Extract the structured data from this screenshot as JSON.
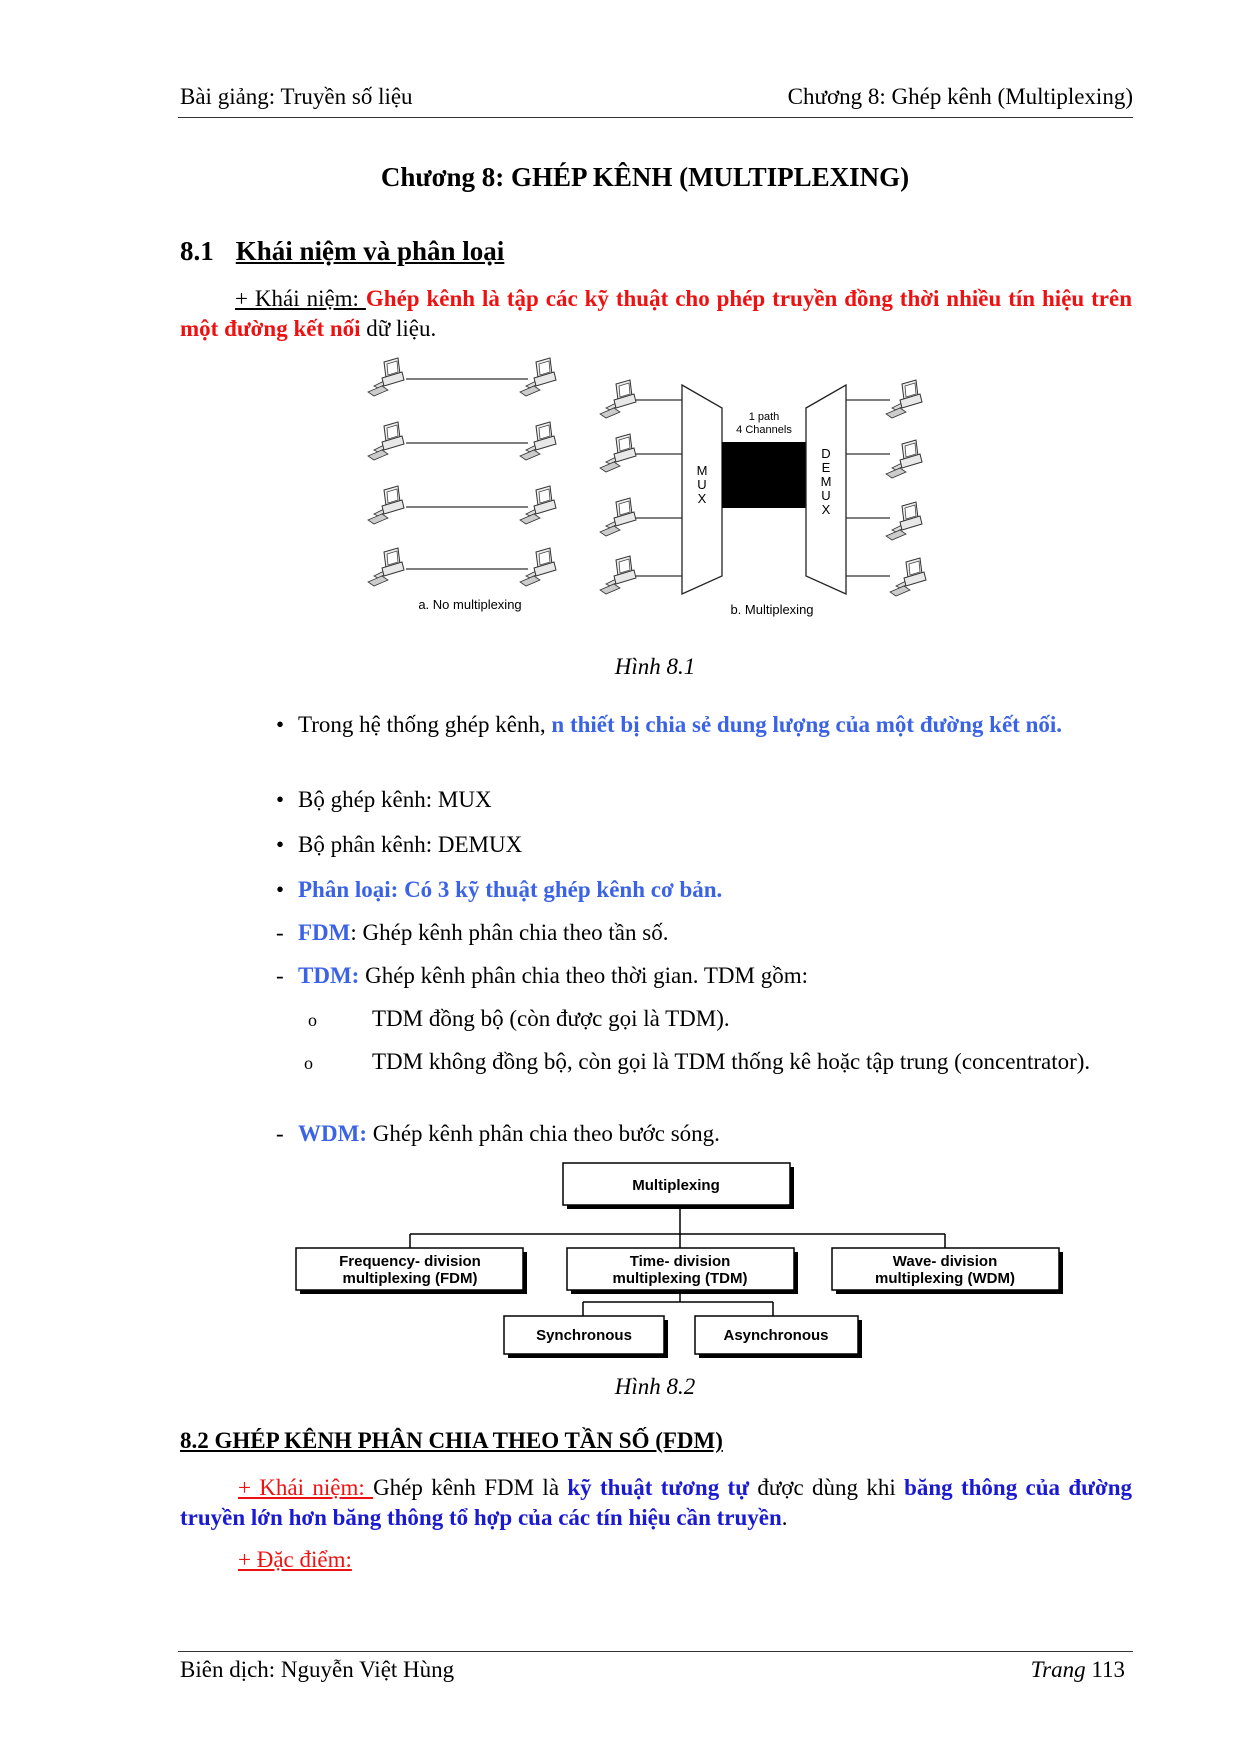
{
  "header": {
    "left": "Bài giảng: Truyền số liệu",
    "right": "Chương 8: Ghép kênh (Multiplexing)"
  },
  "chapter_title": "Chương 8: GHÉP KÊNH (MULTIPLEXING)",
  "section_8_1": {
    "number": "8.1",
    "title": "Khái niệm và phân loại",
    "concept_label": "+ Khái niệm: ",
    "concept_bold": "Ghép kênh là tập các kỹ thuật cho phép truyền đồng thời nhiều tín hiệu trên một đường kết nối",
    "concept_tail": " dữ liệu."
  },
  "figure_8_1": {
    "caption": "Hình 8.1",
    "label_a": "a. No multiplexing",
    "label_b": "b.  Multiplexing",
    "path_line1": "1 path",
    "path_line2": "4 Channels",
    "mux_letters": [
      "M",
      "U",
      "X"
    ],
    "demux_letters": [
      "D",
      "E",
      "M",
      "U",
      "X"
    ]
  },
  "bullets": [
    {
      "plain": "Trong hệ thống ghép kênh, ",
      "highlight": "n thiết bị chia sẻ dung lượng của một đường kết nối."
    },
    {
      "plain": "Bộ ghép kênh: MUX"
    },
    {
      "plain": "Bộ phân kênh: DEMUX"
    },
    {
      "highlight": "Phân loại: Có 3 kỹ thuật ghép kênh cơ bản."
    }
  ],
  "types": [
    {
      "key": "FDM",
      "sep": ":",
      "text": " Ghép kênh phân chia theo tần số."
    },
    {
      "key": "TDM:",
      "sep": "",
      "text": " Ghép kênh phân chia theo thời gian. TDM gồm:"
    },
    {
      "key": "WDM:",
      "sep": "",
      "text": " Ghép kênh phân chia theo bước sóng."
    }
  ],
  "tdm_subitems": [
    "TDM đồng bộ (còn được gọi là TDM).",
    "TDM không đồng bộ, còn gọi là TDM thống kê hoặc tập trung (concentrator)."
  ],
  "figure_8_2": {
    "caption": "Hình 8.2",
    "root": "Multiplexing",
    "fdm": [
      "Frequency- division",
      "multiplexing (FDM)"
    ],
    "tdm": [
      "Time- division",
      "multiplexing (TDM)"
    ],
    "wdm": [
      "Wave- division",
      "multiplexing (WDM)"
    ],
    "sync": "Synchronous",
    "async": "Asynchronous"
  },
  "section_8_2": {
    "title": "8.2 GHÉP KÊNH PHÂN CHIA THEO TẦN SỐ (FDM)",
    "concept_label": "+ Khái niệm: ",
    "p1": "Ghép kênh FDM là ",
    "b1": "kỹ thuật tương tự",
    "p2": " được dùng khi ",
    "b2": "băng thông của đường truyền lớn hơn băng thông tổ hợp của các tín hiệu cần truyền",
    "p3": ".",
    "features_label": "+ Đặc điểm:"
  },
  "footer": {
    "left": "Biên dịch: Nguyễn Việt Hùng",
    "page_word": "Trang",
    "page_number": "113"
  },
  "colors": {
    "red": "#ee1111",
    "blue": "#3b63e6",
    "navy": "#1a1ad0"
  }
}
